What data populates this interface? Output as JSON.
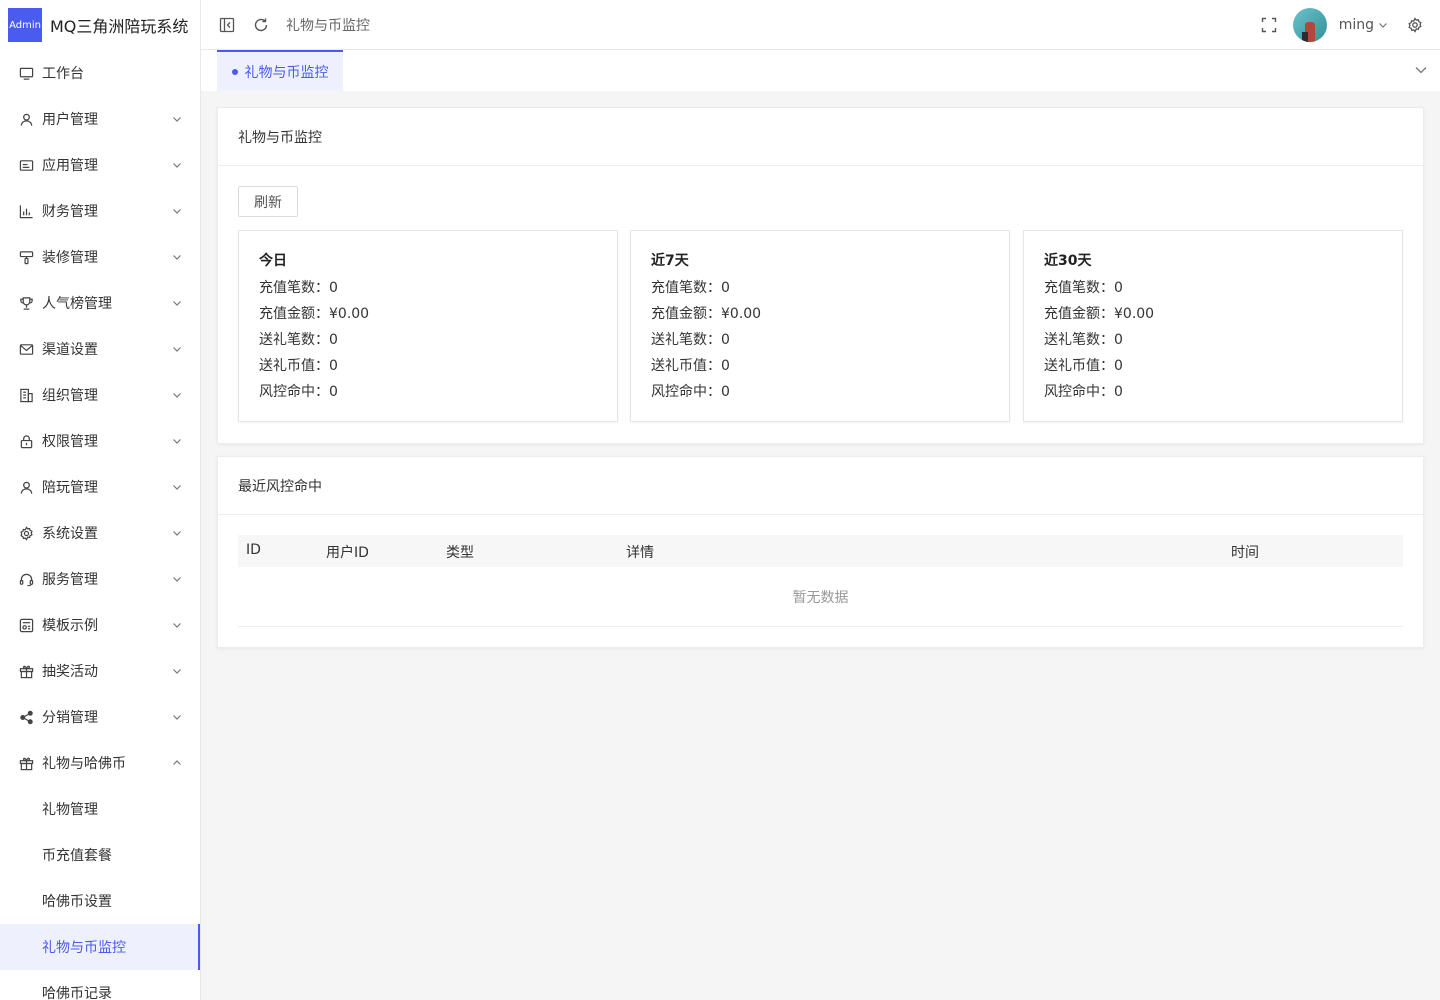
{
  "app": {
    "logo_text": "Admin",
    "title": "MQ三角洲陪玩系统"
  },
  "sidebar": {
    "items": [
      {
        "label": "工作台",
        "icon": "monitor-icon",
        "has_arrow": false
      },
      {
        "label": "用户管理",
        "icon": "user-icon",
        "has_arrow": true
      },
      {
        "label": "应用管理",
        "icon": "app-card-icon",
        "has_arrow": true
      },
      {
        "label": "财务管理",
        "icon": "chart-icon",
        "has_arrow": true
      },
      {
        "label": "装修管理",
        "icon": "brush-icon",
        "has_arrow": true
      },
      {
        "label": "人气榜管理",
        "icon": "trophy-icon",
        "has_arrow": true
      },
      {
        "label": "渠道设置",
        "icon": "mail-icon",
        "has_arrow": true
      },
      {
        "label": "组织管理",
        "icon": "building-icon",
        "has_arrow": true
      },
      {
        "label": "权限管理",
        "icon": "lock-icon",
        "has_arrow": true
      },
      {
        "label": "陪玩管理",
        "icon": "user-icon",
        "has_arrow": true
      },
      {
        "label": "系统设置",
        "icon": "gear-icon",
        "has_arrow": true
      },
      {
        "label": "服务管理",
        "icon": "headset-icon",
        "has_arrow": true
      },
      {
        "label": "模板示例",
        "icon": "template-icon",
        "has_arrow": true
      },
      {
        "label": "抽奖活动",
        "icon": "gift-icon",
        "has_arrow": true
      },
      {
        "label": "分销管理",
        "icon": "share-icon",
        "has_arrow": true
      },
      {
        "label": "礼物与哈佛币",
        "icon": "gift-icon",
        "has_arrow": true,
        "expanded": true
      }
    ],
    "sub_items": [
      {
        "label": "礼物管理",
        "active": false
      },
      {
        "label": "币充值套餐",
        "active": false
      },
      {
        "label": "哈佛币设置",
        "active": false
      },
      {
        "label": "礼物与币监控",
        "active": true
      },
      {
        "label": "哈佛币记录",
        "active": false
      }
    ]
  },
  "header": {
    "breadcrumb": "礼物与币监控",
    "user_name": "ming"
  },
  "tabs": {
    "active_label": "礼物与币监控"
  },
  "monitor_card": {
    "title": "礼物与币监控",
    "refresh_label": "刷新",
    "periods": [
      {
        "title": "今日",
        "lines": [
          "充值笔数：0",
          "充值金额：¥0.00",
          "送礼笔数：0",
          "送礼币值：0",
          "风控命中：0"
        ]
      },
      {
        "title": "近7天",
        "lines": [
          "充值笔数：0",
          "充值金额：¥0.00",
          "送礼笔数：0",
          "送礼币值：0",
          "风控命中：0"
        ]
      },
      {
        "title": "近30天",
        "lines": [
          "充值笔数：0",
          "充值金额：¥0.00",
          "送礼笔数：0",
          "送礼币值：0",
          "风控命中：0"
        ]
      }
    ]
  },
  "risk_card": {
    "title": "最近风控命中",
    "columns": [
      "ID",
      "用户ID",
      "类型",
      "详情",
      "时间"
    ],
    "empty_text": "暂无数据"
  },
  "colors": {
    "accent": "#4a5cf0",
    "active_bg": "#eef0fe"
  }
}
